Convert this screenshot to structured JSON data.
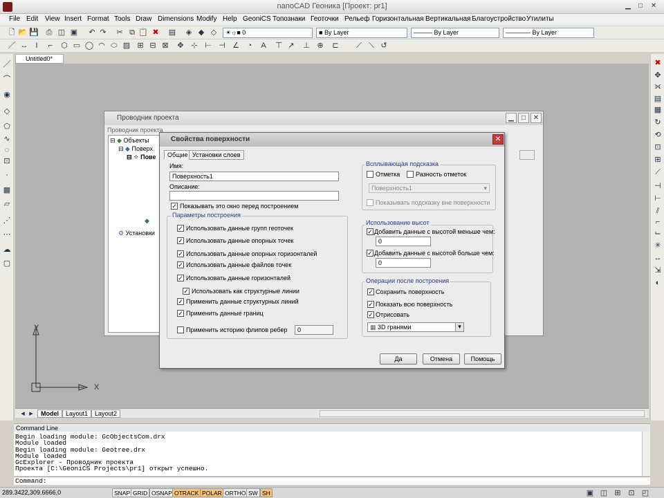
{
  "app": {
    "title": "nanoCAD Геоника [Проект: pr1]"
  },
  "menu": [
    "File",
    "Edit",
    "View",
    "Insert",
    "Format",
    "Tools",
    "Draw",
    "Dimensions",
    "Modify",
    "Help",
    "GeoniCS",
    "Топознаки",
    "Геоточки",
    "Рельеф",
    "Горизонтальная",
    "Вертикальная",
    "Благоустройство",
    "Утилиты"
  ],
  "toolbar": {
    "layer_value": "0",
    "color_value": "By Layer",
    "linetype_value": "By Layer",
    "lineweight_value": "By Layer"
  },
  "document": {
    "tab": "Untitled0*"
  },
  "layout_tabs": [
    "Model",
    "Layout1",
    "Layout2"
  ],
  "ucs": {
    "x_label": "X",
    "y_label": "Y"
  },
  "explorer": {
    "title": "Проводник проекта",
    "breadcrumb": "Проводник проекта",
    "tree": [
      "Объекты",
      "Поверх",
      "Пове",
      "Установки"
    ]
  },
  "dialog": {
    "title": "Свойства поверхности",
    "tabs": [
      "Общие",
      "Установки слоев"
    ],
    "name_label": "Имя:",
    "name_value": "Поверхность1",
    "desc_label": "Описание:",
    "desc_value": "",
    "show_window": {
      "label": "Показывать это окно перед построением",
      "checked": true
    },
    "build_group": {
      "title": "Параметры построения",
      "items": [
        {
          "label": "Использовать данные групп геоточек",
          "checked": true
        },
        {
          "label": "Использовать данные опорных точек",
          "checked": true
        },
        {
          "label": "Использовать данные опорных горизонталей",
          "checked": true
        },
        {
          "label": "Использовать данные файлов точек",
          "checked": true
        },
        {
          "label": "Использовать данные горизонталей",
          "checked": true
        },
        {
          "label": "Использовать как структурные линии",
          "checked": true
        },
        {
          "label": "Применить данные структурных линий",
          "checked": true
        },
        {
          "label": "Применить данные границ",
          "checked": true
        },
        {
          "label": "Применить историю флипов ребер",
          "checked": false
        }
      ],
      "flip_value": "0"
    },
    "tooltip_group": {
      "title": "Всплывающая подсказка",
      "mark": {
        "label": "Отметка",
        "checked": false
      },
      "diff": {
        "label": "Разность отметок",
        "checked": false
      },
      "surface_select": "Поверхность1",
      "outside": {
        "label": "Показывать подсказку вне поверхности",
        "checked": false
      }
    },
    "heights_group": {
      "title": "Использование высот",
      "lower": {
        "label": "Добавить данные с высотой меньше чем:",
        "checked": true,
        "value": "0"
      },
      "higher": {
        "label": "Добавить данные с высотой больше чем:",
        "checked": true,
        "value": "0"
      }
    },
    "after_group": {
      "title": "Операции после построения",
      "items": [
        {
          "label": "Сохранить поверхность",
          "checked": true
        },
        {
          "label": "Показать всю поверхность",
          "checked": true
        },
        {
          "label": "Отрисовать",
          "checked": true
        }
      ],
      "render_select": "3D гранями"
    },
    "buttons": {
      "ok": "Да",
      "cancel": "Отмена",
      "help": "Помощь"
    }
  },
  "command_line": {
    "header": "Command Line",
    "lines": [
      "Begin loading module: GcObjectsCom.drx",
      "Module loaded",
      "Begin loading module: Geotree.drx",
      "Module loaded",
      "GcExplorer - Проводник проекта",
      "Проекта [C:\\GeoniCS Projects\\pr1] открыт успешно."
    ],
    "prompt": "Command:"
  },
  "status": {
    "coords": "289.3422,309.6666,0",
    "buttons": [
      "SNAP",
      "GRID",
      "OSNAP",
      "OTRACK",
      "POLAR",
      "ORTHO",
      "SW",
      "SH"
    ]
  },
  "colors": {
    "canvas": "#b2b2b2",
    "accent": "#2a3a8a",
    "close": "#c43c3c"
  }
}
